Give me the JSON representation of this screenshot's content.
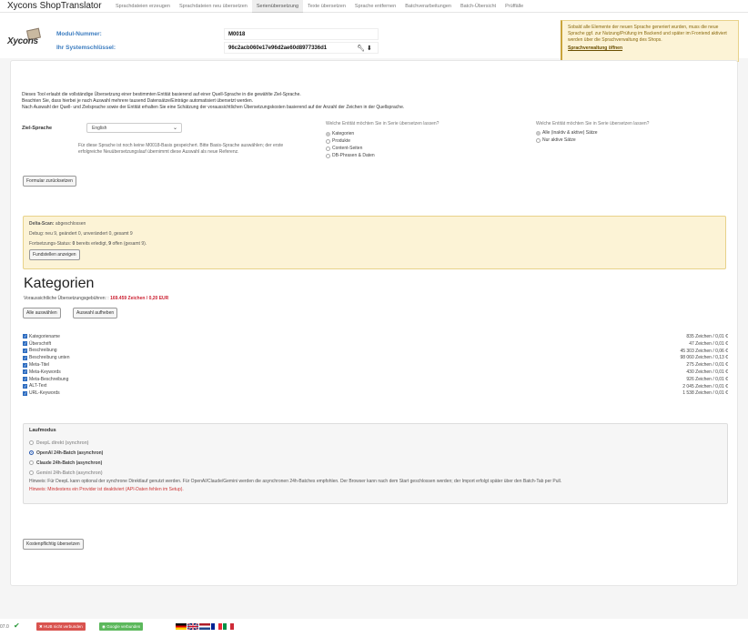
{
  "brand": "Xycons ShopTranslator",
  "nav": [
    {
      "label": "Sprachdateien erzeugen"
    },
    {
      "label": "Sprachdateien neu übersetzen"
    },
    {
      "label": "Serienübersetzung"
    },
    {
      "label": "Texte übersetzen"
    },
    {
      "label": "Sprache entfernen"
    },
    {
      "label": "Batchverarbeitungen"
    },
    {
      "label": "Batch-Übersicht"
    },
    {
      "label": "Prüffälle"
    }
  ],
  "module": {
    "logo_text": "Xycons",
    "number_label": "Modul-Nummer:",
    "number_value": "M0018",
    "key_label": "Ihr Systemschlüssel:",
    "key_value": "96c2acb060e17e96d2ae60d8977336d1"
  },
  "notice": {
    "text": "Sobald alle Elemente der neuen Sprache generiert wurden, muss die neue Sprache ggf. zur Nutzung/Prüfung im Backend und später im Frontend aktiviert werden über die Sprachverwaltung des Shops.",
    "link": "Sprachverwaltung öffnen"
  },
  "intro": [
    "Dieses Tool erlaubt die vollständige Übersetzung einer bestimmten Entität basierend auf einer Quell-Sprache in die gewählte Ziel-Sprache.",
    "Beachten Sie, dass hierbei je nach Auswahl mehrere tausend Datensätze/Einträge automatisiert übersetzt werden.",
    "Nach Auswahl der Quell- und Zielsprache sowie der Entität erhalten Sie eine Schätzung der voraussichtlichen Übersetzungskosten basierend auf der Anzahl der Zeichen in der Quellsprache."
  ],
  "ziel": {
    "label": "Ziel-Sprache",
    "selected": "English",
    "hint": "Für diese Sprache ist noch keine M0018-Basis gespeichert. Bitte Basis-Sprache auswählen; der erste erfolgreiche Neuübersetzungslauf übernimmt diese Auswahl als neue Referenz."
  },
  "entity_q": {
    "label": "Welche Entität möchten Sie in Serie übersetzen lassen?",
    "options": [
      "Kategorien",
      "Produkte",
      "Content-Seiten",
      "DB-Phrasen & Daten"
    ]
  },
  "scope_q": {
    "label": "Welche Entität möchten Sie in Serie übersetzen lassen?",
    "options": [
      "Alle (inaktiv & aktive) Sätze",
      "Nur aktive Sätze"
    ]
  },
  "reset_button": "Formular zurücksetzen",
  "delta": {
    "title": "Delta-Scan:",
    "status": "abgeschlossen",
    "debug": "Debug: neu 9, geändert 0, unverändert 0, gesamt 9",
    "progress_prefix": "Fortsetzungs-Status:",
    "done": "0",
    "done_text": "bereits erledigt,",
    "open": "9",
    "open_text": "offen (gesamt 9).",
    "button": "Fundstellen anzeigen"
  },
  "kategorien": {
    "title": "Kategorien",
    "fees_label": "Voraussichtliche Übersetzungsgebühren: :",
    "fees_value": "169.459 Zeichen / 0,20 EUR",
    "select_all": "Alle auswählen",
    "deselect_all": "Auswahl aufheben",
    "fields": [
      {
        "label": "Kategoriename",
        "cost": "835 Zeichen / 0,01 €"
      },
      {
        "label": "Überschrift",
        "cost": "47 Zeichen / 0,01 €"
      },
      {
        "label": "Beschreibung",
        "cost": "45 303 Zeichen / 0,06 €"
      },
      {
        "label": "Beschreibung unten",
        "cost": "98 060 Zeichen / 0,13 €"
      },
      {
        "label": "Meta-Titel",
        "cost": "275 Zeichen / 0,01 €"
      },
      {
        "label": "Meta-Keywords",
        "cost": "430 Zeichen / 0,01 €"
      },
      {
        "label": "Meta-Beschreibung",
        "cost": "926 Zeichen / 0,01 €"
      },
      {
        "label": "ALT-Text",
        "cost": "2 045 Zeichen / 0,01 €"
      },
      {
        "label": "URL-Keywords",
        "cost": "1 538 Zeichen / 0,01 €"
      }
    ]
  },
  "laufmodus": {
    "title": "Laufmodus",
    "options": [
      {
        "label": "DeepL direkt (synchron)",
        "selected": false,
        "disabled": true
      },
      {
        "label": "OpenAI 24h-Batch (asynchron)",
        "selected": true,
        "disabled": false
      },
      {
        "label": "Claude 24h-Batch (asynchron)",
        "selected": false,
        "disabled": false
      },
      {
        "label": "Gemini 24h-Batch (asynchron)",
        "selected": false,
        "disabled": true
      }
    ],
    "note": "Hinweis: Für DeepL kann optional der synchrone Direktlauf genutzt werden. Für OpenAI/Claude/Gemini werden die asynchronen 24h-Batches empfohlen. Der Browser kann nach dem Start geschlossen werden; der Import erfolgt später über den Batch-Tab per Pull.",
    "warn": "Hinweis: Mindestens ein Provider ist deaktiviert (API-Daten fehlen im Setup)."
  },
  "submit_button": "Kostenpflichtig übersetzen",
  "footer": {
    "version": "07.0",
    "hub": "HUB nicht verbunden",
    "google": "Google verbunden"
  },
  "colors": {
    "accent": "#3a7bbf",
    "warn_bg": "#fcf3d6",
    "danger": "#d9534f",
    "success": "#5cb85c"
  }
}
